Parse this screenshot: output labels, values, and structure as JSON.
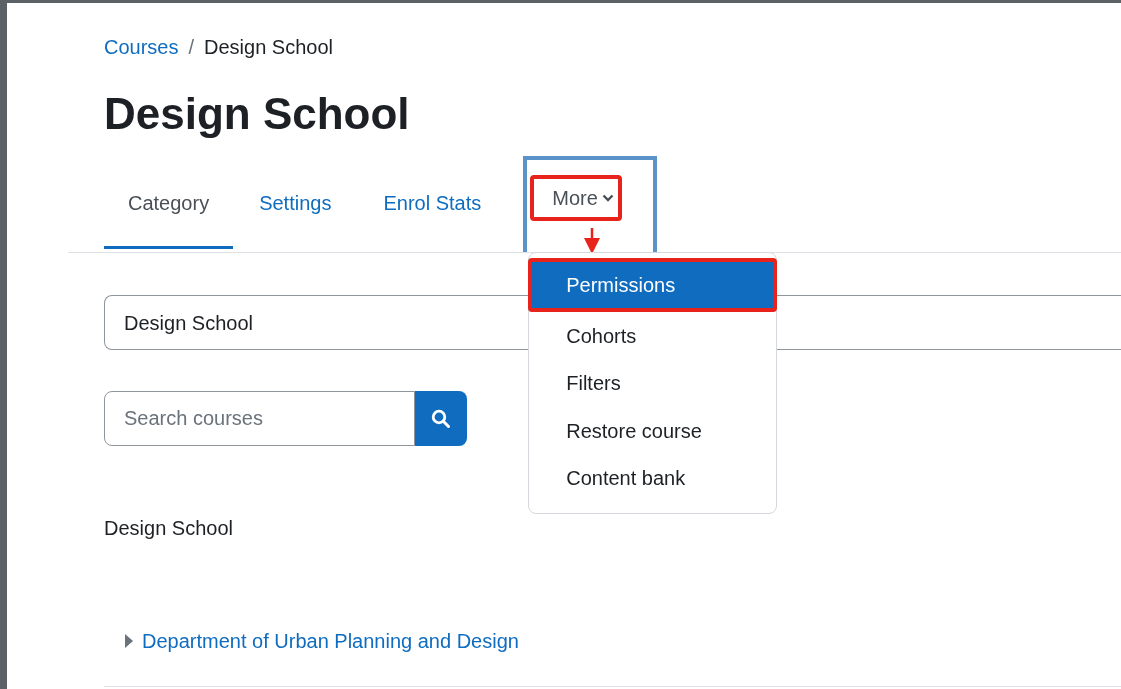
{
  "breadcrumb": [
    {
      "label": "Courses",
      "kind": "link"
    },
    {
      "label": "/",
      "kind": "separator"
    },
    {
      "label": "Design School",
      "kind": "current"
    }
  ],
  "title": "Design School",
  "tabs": [
    {
      "label": "Category",
      "selected": true
    },
    {
      "label": "Settings",
      "selected": false
    },
    {
      "label": "Enrol Stats",
      "selected": false
    }
  ],
  "more_menu": {
    "label": "More",
    "items": [
      {
        "label": "Permissions",
        "selected": true
      },
      {
        "label": "Cohorts",
        "selected": false
      },
      {
        "label": "Filters",
        "selected": false
      },
      {
        "label": "Restore course",
        "selected": false
      },
      {
        "label": "Content bank",
        "selected": false
      }
    ]
  },
  "category_select": {
    "value": "Design School"
  },
  "search": {
    "placeholder": "Search courses"
  },
  "category_heading": "Design School",
  "subcategories": [
    {
      "label": "Department of Urban Planning and Design",
      "expanded": false
    }
  ]
}
